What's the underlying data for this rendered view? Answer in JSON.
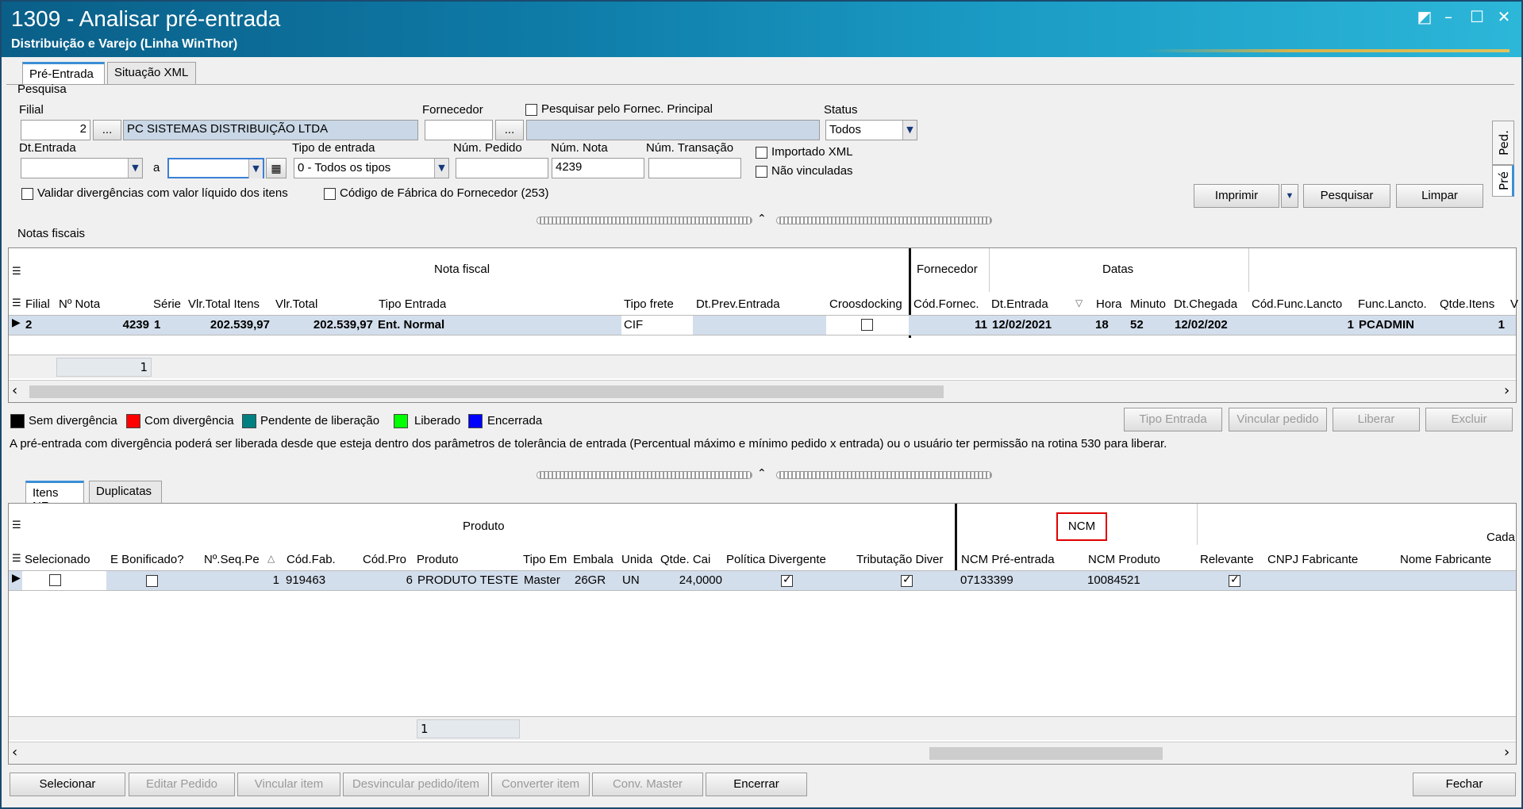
{
  "window": {
    "title": "1309 - Analisar pré-entrada",
    "subtitle": "Distribuição e Varejo (Linha WinThor)",
    "controls": [
      "◩",
      "–",
      "☐",
      "✕"
    ]
  },
  "top_tabs": [
    "Pré-Entrada",
    "Situação XML"
  ],
  "side_tabs": [
    "Ped.",
    "Pré"
  ],
  "search": {
    "group_label": "Pesquisa",
    "filial_label": "Filial",
    "filial_code": "2",
    "filial_name": "PC SISTEMAS DISTRIBUIÇÃO LTDA",
    "ellipsis": "...",
    "fornecedor_label": "Fornecedor",
    "fornecedor_code": "",
    "fornecedor_name": "",
    "pesquisar_principal": "Pesquisar pelo Fornec. Principal",
    "status_label": "Status",
    "status_value": "Todos",
    "dt_entrada_label": "Dt.Entrada",
    "dt_a": "a",
    "tipo_entrada_label": "Tipo de entrada",
    "tipo_entrada_value": "0 - Todos os tipos",
    "num_pedido_label": "Núm. Pedido",
    "num_pedido_value": "",
    "num_nota_label": "Núm. Nota",
    "num_nota_value": "4239",
    "num_transacao_label": "Núm. Transação",
    "num_transacao_value": "",
    "importado_xml": "Importado XML",
    "nao_vinculadas": "Não vinculadas",
    "validar_div": "Validar divergências com valor líquido dos itens",
    "codigo_fabrica": "Código de Fábrica do Fornecedor (253)",
    "btn_imprimir": "Imprimir",
    "btn_pesquisar": "Pesquisar",
    "btn_limpar": "Limpar"
  },
  "notas": {
    "group_label": "Notas fiscais",
    "band_nota": "Nota fiscal",
    "band_fornecedor": "Fornecedor",
    "band_datas": "Datas",
    "columns": [
      "Filial",
      "Nº Nota",
      "Série",
      "Vlr.Total Itens",
      "Vlr.Total",
      "Tipo Entrada",
      "Tipo frete",
      "Dt.Prev.Entrada",
      "Croosdocking",
      "Cód.Fornec.",
      "Dt.Entrada",
      "Hora",
      "Minuto",
      "Dt.Chegada",
      "Cód.Func.Lancto",
      "Func.Lancto.",
      "Qtde.Itens",
      "V"
    ],
    "row": [
      "2",
      "4239",
      "1",
      "202.539,97",
      "202.539,97",
      "Ent. Normal",
      "CIF",
      "",
      "",
      "11",
      "12/02/2021",
      "18",
      "52",
      "12/02/202",
      "1",
      "PCADMIN",
      "1",
      ""
    ],
    "footer_count": "1"
  },
  "legend": [
    {
      "label": "Sem divergência",
      "color": "#000000"
    },
    {
      "label": "Com divergência",
      "color": "#ff0000"
    },
    {
      "label": "Pendente de liberação",
      "color": "#008080"
    },
    {
      "label": "Liberado",
      "color": "#00ff00"
    },
    {
      "label": "Encerrada",
      "color": "#0000ff"
    }
  ],
  "actions": {
    "tipo_entrada": "Tipo Entrada",
    "vincular_pedido": "Vincular pedido",
    "liberar": "Liberar",
    "excluir": "Excluir"
  },
  "info_text": "A pré-entrada com divergência poderá ser liberada desde que esteja dentro dos parâmetros de tolerância de entrada (Percentual máximo e mínimo pedido x entrada) ou o usuário ter permissão na rotina 530 para liberar.",
  "bottom_tabs": [
    "Itens NF",
    "Duplicatas"
  ],
  "itens": {
    "band_produto": "Produto",
    "band_ncm": "NCM",
    "band_cada": "Cada",
    "columns": [
      "Selecionado",
      "E Bonificado?",
      "Nº.Seq.Pe",
      "Cód.Fab.",
      "Cód.Pro",
      "Produto",
      "Tipo Em",
      "Embala",
      "Unida",
      "Qtde. Cai",
      "Política Divergente",
      "Tributação Diver",
      "NCM Pré-entrada",
      "NCM Produto",
      "Relevante",
      "CNPJ Fabricante",
      "Nome Fabricante"
    ],
    "row": [
      "",
      "",
      "1",
      "919463",
      "6",
      "PRODUTO TESTE",
      "Master",
      "26GR",
      "UN",
      "24,0000",
      "",
      "",
      "07133399",
      "10084521",
      "",
      "",
      ""
    ],
    "footer_count": "1"
  },
  "bottom_buttons": {
    "selecionar": "Selecionar",
    "editar_pedido": "Editar Pedido",
    "vincular_item": "Vincular item",
    "desvincular": "Desvincular pedido/item",
    "converter_item": "Converter item",
    "conv_master": "Conv. Master",
    "encerrar": "Encerrar",
    "fechar": "Fechar"
  },
  "highlight_color": "#e00000"
}
